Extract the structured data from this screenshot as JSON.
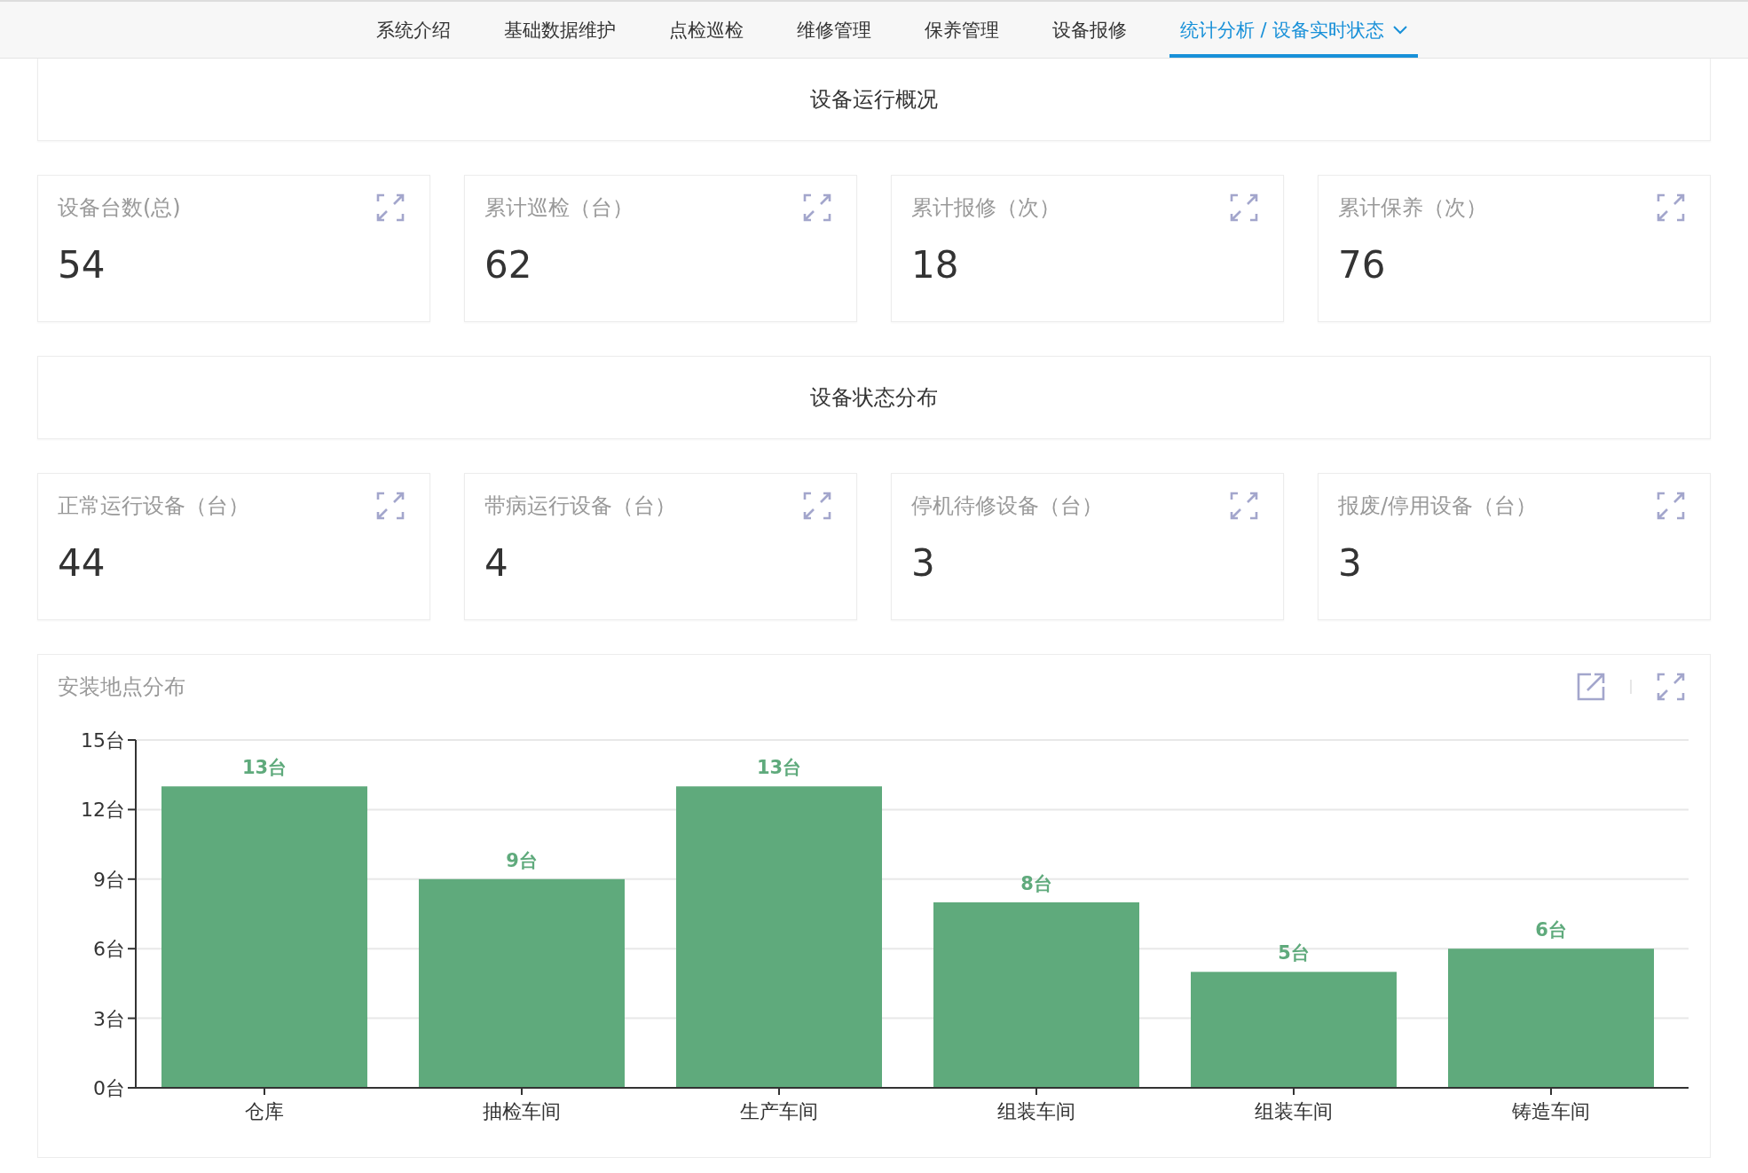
{
  "nav": {
    "tabs": [
      {
        "label": "系统介绍",
        "selected": false,
        "dropdown": false
      },
      {
        "label": "基础数据维护",
        "selected": false,
        "dropdown": false
      },
      {
        "label": "点检巡检",
        "selected": false,
        "dropdown": false
      },
      {
        "label": "维修管理",
        "selected": false,
        "dropdown": false
      },
      {
        "label": "保养管理",
        "selected": false,
        "dropdown": false
      },
      {
        "label": "设备报修",
        "selected": false,
        "dropdown": false
      },
      {
        "label": "统计分析 / 设备实时状态",
        "selected": true,
        "dropdown": true
      }
    ]
  },
  "sections": [
    {
      "title": "设备运行概况",
      "cards": [
        {
          "label": "设备台数(总)",
          "value": "54"
        },
        {
          "label": "累计巡检（台）",
          "value": "62"
        },
        {
          "label": "累计报修（次）",
          "value": "18"
        },
        {
          "label": "累计保养（次）",
          "value": "76"
        }
      ]
    },
    {
      "title": "设备状态分布",
      "cards": [
        {
          "label": "正常运行设备（台）",
          "value": "44"
        },
        {
          "label": "带病运行设备（台）",
          "value": "4"
        },
        {
          "label": "停机待修设备（台）",
          "value": "3"
        },
        {
          "label": "报废/停用设备（台）",
          "value": "3"
        }
      ]
    }
  ],
  "location_panel": {
    "title": "安装地点分布",
    "chart_data": {
      "type": "bar",
      "categories": [
        "仓库",
        "抽检车间",
        "生产车间",
        "组装车间",
        "组装车间",
        "铸造车间"
      ],
      "series": [
        {
          "color": "#5faa7c",
          "values": [
            13,
            9,
            13,
            8,
            5,
            6
          ]
        }
      ],
      "grid": true,
      "ylim": [
        0,
        15
      ],
      "yticks": [
        {
          "value": 0,
          "label": "0台"
        },
        {
          "value": 3,
          "label": "3台"
        },
        {
          "value": 6,
          "label": "6台"
        },
        {
          "value": 9,
          "label": "9台"
        },
        {
          "value": 12,
          "label": "12台"
        },
        {
          "value": 15,
          "label": "15台"
        }
      ],
      "value_labels": [
        "13台",
        "9台",
        "13台",
        "8台",
        "5台",
        "6台"
      ]
    }
  }
}
